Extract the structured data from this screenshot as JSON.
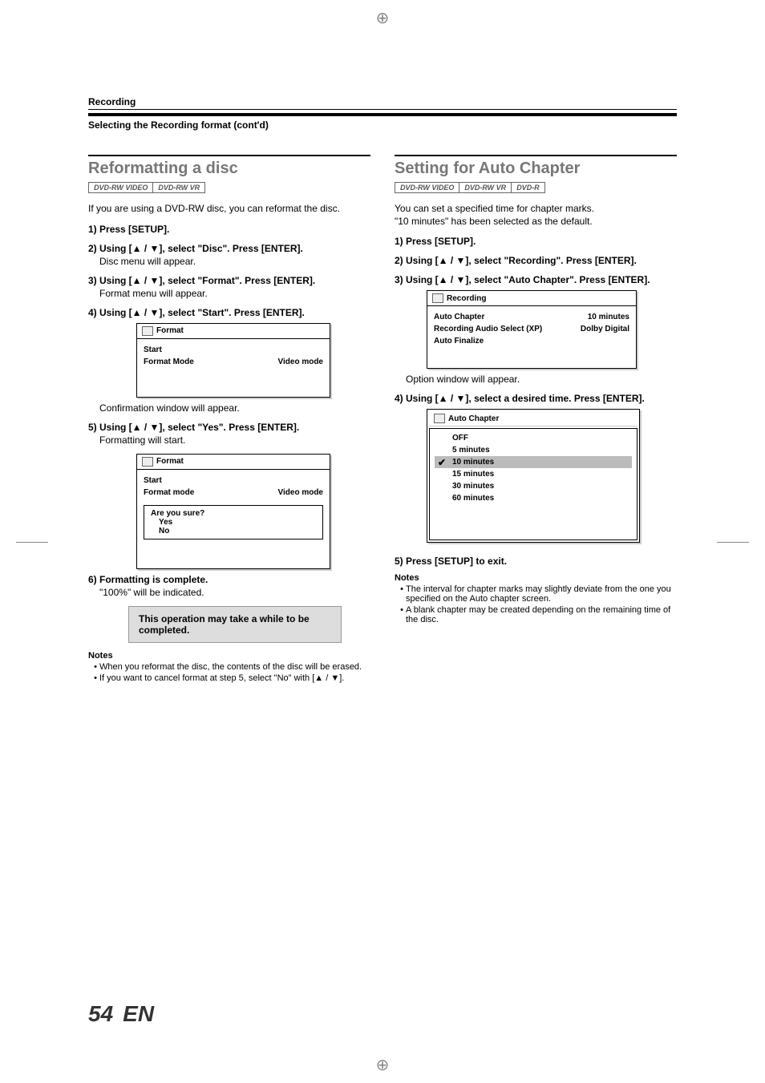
{
  "crumb": "Recording",
  "subtitle": "Selecting the Recording format (cont'd)",
  "page_number": "54",
  "page_lang": "EN",
  "left": {
    "heading": "Reformatting a disc",
    "badges": [
      "DVD-RW VIDEO",
      "DVD-RW VR"
    ],
    "intro": "If you are using a DVD-RW disc, you can reformat the disc.",
    "steps": [
      {
        "num": "1)",
        "text": "Press [SETUP]."
      },
      {
        "num": "2)",
        "text": "Using [▲ / ▼], select \"Disc\". Press [ENTER].",
        "sub": "Disc menu will appear."
      },
      {
        "num": "3)",
        "text": "Using [▲ / ▼], select \"Format\". Press [ENTER].",
        "sub": "Format menu will appear."
      },
      {
        "num": "4)",
        "text": "Using [▲ / ▼], select \"Start\". Press [ENTER]."
      }
    ],
    "box1": {
      "title": "Format",
      "rows": [
        {
          "left": "Start",
          "right": ""
        },
        {
          "left": "Format Mode",
          "right": "Video mode"
        }
      ]
    },
    "after_box1": "Confirmation window will appear.",
    "step5": {
      "num": "5)",
      "text": "Using [▲ / ▼], select \"Yes\". Press [ENTER].",
      "sub": "Formatting will start."
    },
    "box2": {
      "title": "Format",
      "rows": [
        {
          "left": "Start",
          "right": ""
        },
        {
          "left": "Format mode",
          "right": "Video mode"
        }
      ],
      "confirm": {
        "q": "Are you sure?",
        "yes": "Yes",
        "no": "No"
      }
    },
    "step6": {
      "num": "6)",
      "text": "Formatting is complete.",
      "sub": "\"100%\" will be indicated."
    },
    "callout": "This operation may take a while to be completed.",
    "notes_head": "Notes",
    "notes": [
      "When you reformat the disc, the contents of the disc will be erased.",
      "If you want to cancel format at step 5, select \"No\" with [▲ / ▼]."
    ]
  },
  "right": {
    "heading": "Setting for Auto Chapter",
    "badges": [
      "DVD-RW VIDEO",
      "DVD-RW VR",
      "DVD-R"
    ],
    "intro_l1": "You can set a specified time for chapter marks.",
    "intro_l2": "\"10 minutes\" has been selected as the default.",
    "steps": [
      {
        "num": "1)",
        "text": "Press [SETUP]."
      },
      {
        "num": "2)",
        "text": "Using [▲ / ▼], select \"Recording\". Press [ENTER]."
      },
      {
        "num": "3)",
        "text": "Using [▲ / ▼], select \"Auto Chapter\". Press [ENTER]."
      }
    ],
    "box1": {
      "title": "Recording",
      "rows": [
        {
          "left": "Auto Chapter",
          "right": "10 minutes"
        },
        {
          "left": "Recording Audio Select (XP)",
          "right": "Dolby Digital"
        },
        {
          "left": "Auto Finalize",
          "right": ""
        }
      ]
    },
    "after_box1": "Option window will appear.",
    "step4": {
      "num": "4)",
      "text": "Using [▲ / ▼], select a desired time.  Press [ENTER]."
    },
    "opt_box": {
      "title": "Auto Chapter",
      "options": [
        "OFF",
        "5 minutes",
        "10 minutes",
        "15 minutes",
        "30 minutes",
        "60 minutes"
      ],
      "selected_index": 2
    },
    "step5": {
      "num": "5)",
      "text": "Press [SETUP] to exit."
    },
    "notes_head": "Notes",
    "notes": [
      "The interval for chapter marks may slightly deviate from the one you specified on the Auto chapter screen.",
      "A blank chapter may be created depending on the remaining time of the disc."
    ]
  }
}
